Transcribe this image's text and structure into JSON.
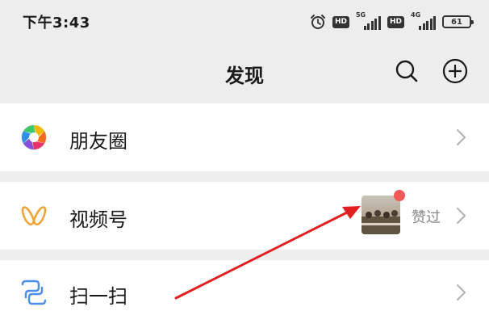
{
  "status_bar": {
    "time": "下午3:43",
    "alarm_icon": "alarm-clock-icon",
    "hd_label": "HD",
    "network_1": "5G",
    "network_2": "4G",
    "battery_level": "61"
  },
  "nav": {
    "title": "发现",
    "search_icon": "search-icon",
    "add_icon": "plus-circle-icon"
  },
  "menu": {
    "moments": {
      "label": "朋友圈",
      "icon": "aperture-icon"
    },
    "channels": {
      "label": "视频号",
      "icon": "butterfly-icon",
      "hint": "赞过",
      "has_red_dot": true
    },
    "scan": {
      "label": "扫一扫",
      "icon": "scan-icon"
    }
  },
  "colors": {
    "background": "#ededed",
    "cell": "#ffffff",
    "badge": "#f25a5a",
    "annotation_arrow": "#e02020"
  }
}
